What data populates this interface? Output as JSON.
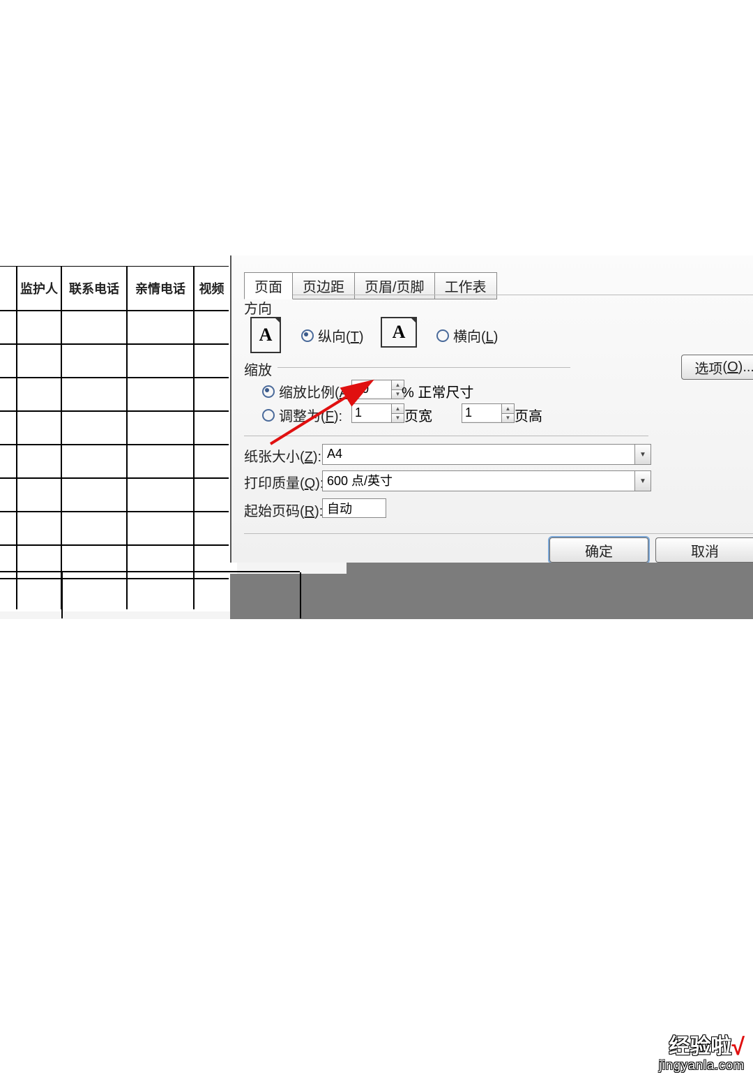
{
  "sheet": {
    "headers": [
      "监护人",
      "联系电话",
      "亲情电话",
      "视频"
    ]
  },
  "dialog": {
    "tabs": [
      "页面",
      "页边距",
      "页眉/页脚",
      "工作表"
    ],
    "direction_label": "方向",
    "portrait": {
      "label": "纵向",
      "hotkey": "T"
    },
    "landscape": {
      "label": "横向",
      "hotkey": "L"
    },
    "zoom_label": "缩放",
    "scale": {
      "label": "缩放比例",
      "hotkey": "A",
      "value": "90",
      "suffix": "% 正常尺寸"
    },
    "fit": {
      "label": "调整为",
      "hotkey": "F",
      "w_value": "1",
      "w_label": "页宽",
      "h_value": "1",
      "h_label": "页高"
    },
    "paper": {
      "label": "纸张大小",
      "hotkey": "Z",
      "value": "A4"
    },
    "quality": {
      "label": "打印质量",
      "hotkey": "Q",
      "value": "600 点/英寸"
    },
    "firstpage": {
      "label": "起始页码",
      "hotkey": "R",
      "value": "自动"
    },
    "options": {
      "label": "选项",
      "hotkey": "O"
    },
    "ok": "确定",
    "cancel": "取消"
  },
  "watermark": {
    "brand": "经验啦",
    "site": "jingyanla.com"
  }
}
